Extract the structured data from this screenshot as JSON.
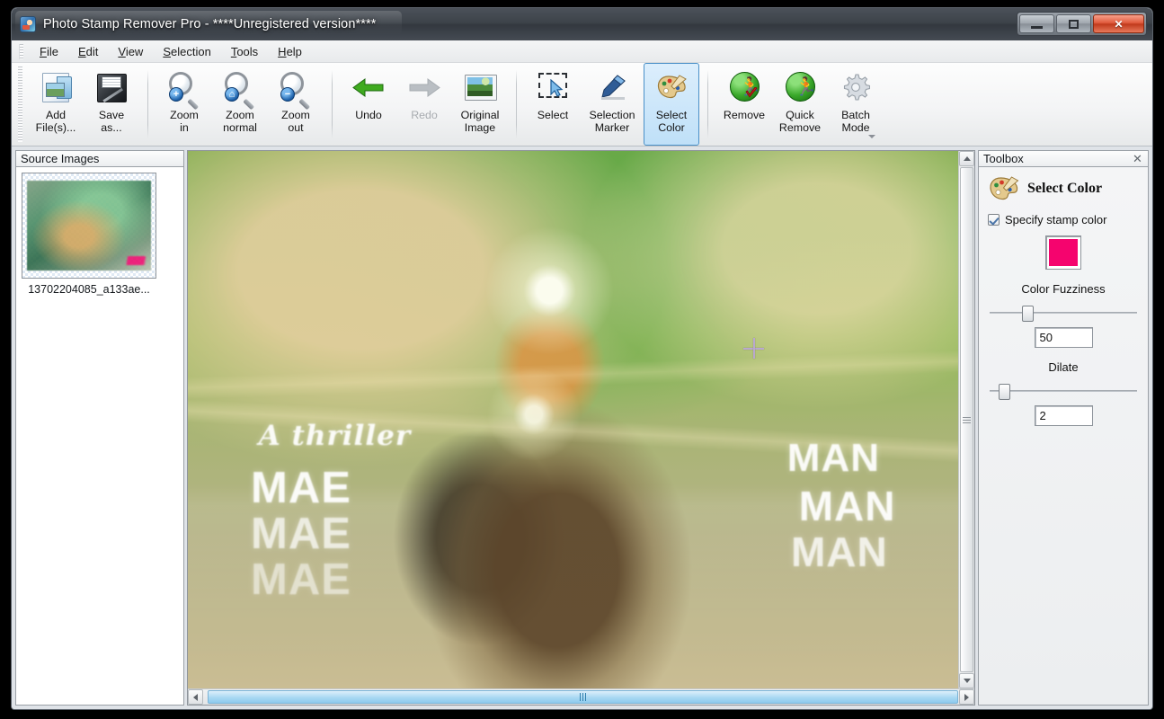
{
  "window": {
    "title": "Photo Stamp Remover Pro - ****Unregistered version****",
    "app_icon": "app-photo-icon",
    "minimize_label": "Minimize",
    "maximize_label": "Restore",
    "close_label": "Close"
  },
  "menubar": {
    "items": [
      {
        "label": "File",
        "accel": "F"
      },
      {
        "label": "Edit",
        "accel": "E"
      },
      {
        "label": "View",
        "accel": "V"
      },
      {
        "label": "Selection",
        "accel": "S"
      },
      {
        "label": "Tools",
        "accel": "T"
      },
      {
        "label": "Help",
        "accel": "H"
      }
    ]
  },
  "toolbar": {
    "overflow_label": "More buttons",
    "buttons": [
      {
        "id": "add-files",
        "label": "Add\nFile(s)...",
        "icon": "add-image-icon",
        "enabled": true,
        "active": false
      },
      {
        "id": "save-as",
        "label": "Save\nas...",
        "icon": "floppy-disk-icon",
        "enabled": true,
        "active": false
      },
      {
        "id": "zoom-in",
        "label": "Zoom\nin",
        "icon": "magnifier-plus-icon",
        "enabled": true,
        "active": false
      },
      {
        "id": "zoom-normal",
        "label": "Zoom\nnormal",
        "icon": "magnifier-home-icon",
        "enabled": true,
        "active": false
      },
      {
        "id": "zoom-out",
        "label": "Zoom\nout",
        "icon": "magnifier-minus-icon",
        "enabled": true,
        "active": false
      },
      {
        "id": "undo",
        "label": "Undo",
        "icon": "undo-arrow-icon",
        "enabled": true,
        "active": false
      },
      {
        "id": "redo",
        "label": "Redo",
        "icon": "redo-arrow-icon",
        "enabled": false,
        "active": false
      },
      {
        "id": "original-image",
        "label": "Original\nImage",
        "icon": "picture-icon",
        "enabled": true,
        "active": false
      },
      {
        "id": "select",
        "label": "Select",
        "icon": "marquee-select-icon",
        "enabled": true,
        "active": false
      },
      {
        "id": "selection-marker",
        "label": "Selection\nMarker",
        "icon": "marker-pen-icon",
        "enabled": true,
        "active": false
      },
      {
        "id": "select-color",
        "label": "Select\nColor",
        "icon": "palette-icon",
        "enabled": true,
        "active": true
      },
      {
        "id": "remove",
        "label": "Remove",
        "icon": "runner-check-icon",
        "enabled": true,
        "active": false
      },
      {
        "id": "quick-remove",
        "label": "Quick\nRemove",
        "icon": "runner-icon",
        "enabled": true,
        "active": false
      },
      {
        "id": "batch-mode",
        "label": "Batch\nMode",
        "icon": "gear-icon",
        "enabled": true,
        "active": false
      }
    ]
  },
  "source_panel": {
    "caption": "Source Images",
    "items": [
      {
        "filename": "13702204085_a133ae...",
        "selected": true
      }
    ]
  },
  "viewer": {
    "photo_alt": "Stage photo of a man in sunglasses and cap with green smoke and projected text",
    "projected_text": {
      "thriller": "A thriller",
      "mae_1": "MAE",
      "mae_2": "MAE",
      "mae_3": "MAE",
      "man_1": "MAN",
      "man_2": "MAN",
      "man_3": "MAN"
    },
    "cursor": "crosshair-cursor",
    "hscroll": {
      "up_icon": "arrow-left-icon",
      "down_icon": "arrow-right-icon",
      "grip_icon": "grip-icon"
    },
    "vscroll": {
      "up_icon": "arrow-up-icon",
      "down_icon": "arrow-down-icon",
      "grip_icon": "grip-icon"
    }
  },
  "toolbox": {
    "caption": "Toolbox",
    "close_icon": "close-icon",
    "title": "Select Color",
    "title_icon": "palette-icon",
    "specify_stamp_color": {
      "label": "Specify stamp color",
      "checked": true
    },
    "stamp_color": "#F5046E",
    "color_fuzziness": {
      "label": "Color Fuzziness",
      "value": "50",
      "slider_percent": 22
    },
    "dilate": {
      "label": "Dilate",
      "value": "2",
      "slider_percent": 6
    }
  },
  "colors": {
    "accent": "#4a90c8",
    "stamp_pink": "#F5046E",
    "titlebar": "#3d434a",
    "close_red": "#c03a1c"
  }
}
